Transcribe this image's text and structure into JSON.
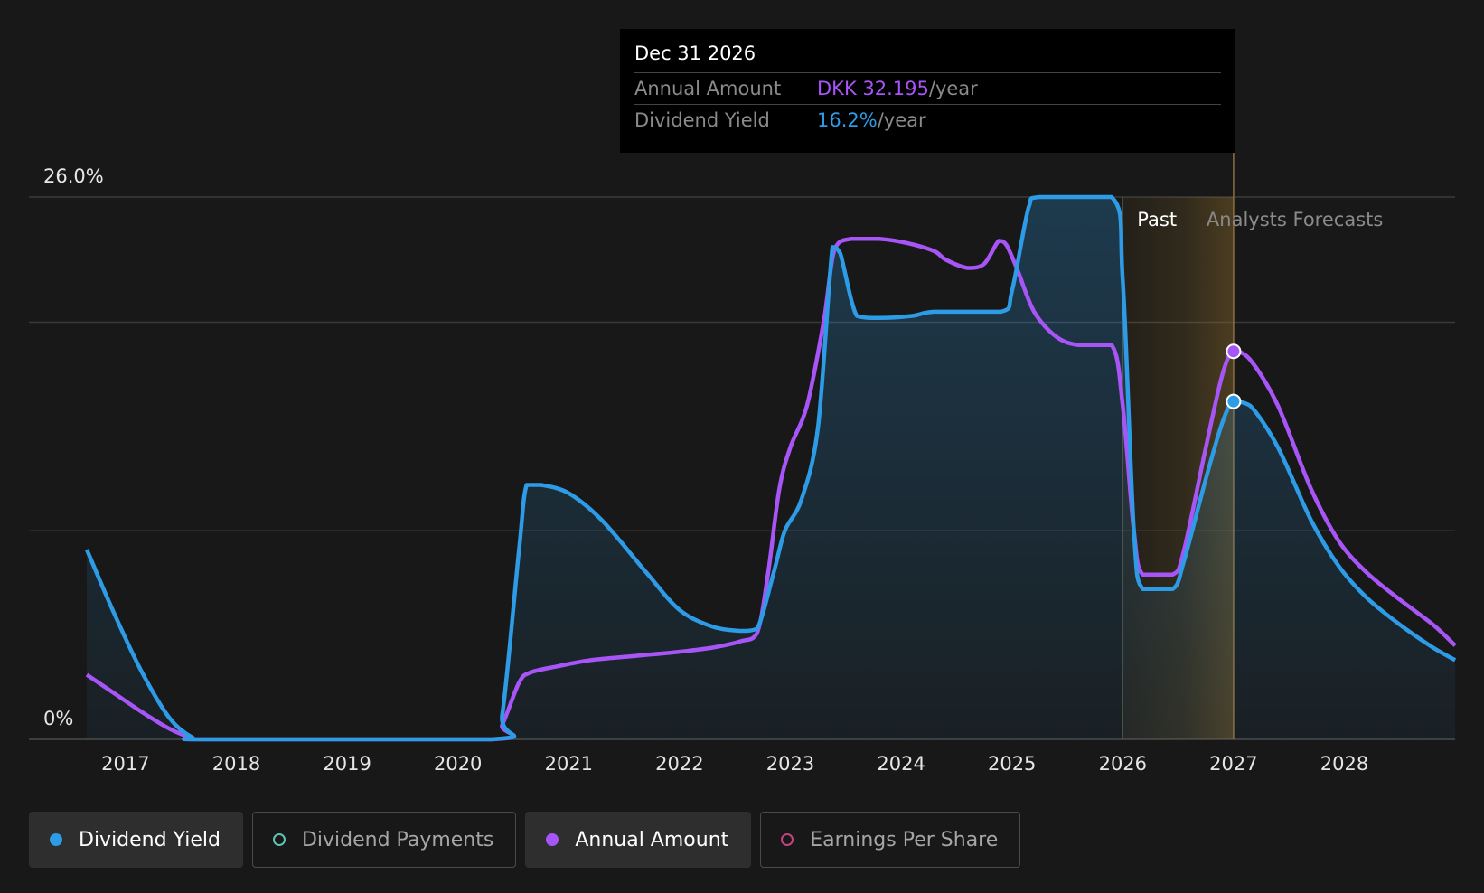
{
  "tooltip": {
    "date": "Dec 31 2026",
    "rows": [
      {
        "label": "Annual Amount",
        "value": "DKK 32.195",
        "unit": "/year",
        "color": "#a855f7"
      },
      {
        "label": "Dividend Yield",
        "value": "16.2%",
        "unit": "/year",
        "color": "#2d9be5"
      }
    ]
  },
  "legend": [
    {
      "label": "Dividend Yield",
      "color": "#2d9be5",
      "filled": true,
      "active": true
    },
    {
      "label": "Dividend Payments",
      "color": "#5ec4b6",
      "filled": false,
      "active": false
    },
    {
      "label": "Annual Amount",
      "color": "#a855f7",
      "filled": true,
      "active": true
    },
    {
      "label": "Earnings Per Share",
      "color": "#c0457e",
      "filled": false,
      "active": false
    }
  ],
  "chart_data": {
    "type": "line",
    "y_top_label": "26.0%",
    "y_bottom_label": "0%",
    "ylim": [
      0,
      26.0
    ],
    "xlim": [
      2016.65,
      2029.0
    ],
    "x_ticks": [
      "2017",
      "2018",
      "2019",
      "2020",
      "2021",
      "2022",
      "2023",
      "2024",
      "2025",
      "2026",
      "2027",
      "2028"
    ],
    "regions": {
      "past_label": "Past",
      "forecast_label": "Analysts Forecasts",
      "past_end": 2026.0,
      "now": 2027.0
    },
    "colors": {
      "yield": "#2d9be5",
      "amount": "#a855f7"
    },
    "series": [
      {
        "name": "Dividend Yield",
        "points": [
          [
            2016.65,
            9.1
          ],
          [
            2016.9,
            6.0
          ],
          [
            2017.15,
            3.2
          ],
          [
            2017.4,
            1.0
          ],
          [
            2017.6,
            0.1
          ],
          [
            2017.75,
            0
          ],
          [
            2020.3,
            0
          ],
          [
            2020.4,
            1.2
          ],
          [
            2020.55,
            9.0
          ],
          [
            2020.62,
            12.2
          ],
          [
            2020.75,
            12.2
          ],
          [
            2021.0,
            11.8
          ],
          [
            2021.3,
            10.5
          ],
          [
            2021.7,
            8.0
          ],
          [
            2022.0,
            6.2
          ],
          [
            2022.3,
            5.4
          ],
          [
            2022.55,
            5.2
          ],
          [
            2022.7,
            5.3
          ],
          [
            2022.85,
            8.0
          ],
          [
            2022.95,
            10.0
          ],
          [
            2023.1,
            11.5
          ],
          [
            2023.25,
            15.0
          ],
          [
            2023.38,
            23.6
          ],
          [
            2023.45,
            23.3
          ],
          [
            2023.6,
            20.3
          ],
          [
            2023.8,
            20.2
          ],
          [
            2024.1,
            20.3
          ],
          [
            2024.3,
            20.5
          ],
          [
            2024.9,
            20.5
          ],
          [
            2025.0,
            21.5
          ],
          [
            2025.15,
            25.5
          ],
          [
            2025.25,
            26.0
          ],
          [
            2025.9,
            26.0
          ],
          [
            2026.0,
            22.0
          ],
          [
            2026.1,
            10.0
          ],
          [
            2026.18,
            7.2
          ],
          [
            2026.45,
            7.2
          ],
          [
            2026.55,
            8.5
          ],
          [
            2026.75,
            12.5
          ],
          [
            2026.9,
            15.2
          ],
          [
            2027.0,
            16.2
          ],
          [
            2027.15,
            16.0
          ],
          [
            2027.4,
            14.0
          ],
          [
            2027.7,
            10.5
          ],
          [
            2027.95,
            8.3
          ],
          [
            2028.2,
            6.8
          ],
          [
            2028.5,
            5.5
          ],
          [
            2028.8,
            4.4
          ],
          [
            2029.0,
            3.8
          ]
        ]
      },
      {
        "name": "Annual Amount",
        "points": [
          [
            2016.65,
            3.1
          ],
          [
            2016.9,
            2.2
          ],
          [
            2017.15,
            1.3
          ],
          [
            2017.4,
            0.5
          ],
          [
            2017.6,
            0.08
          ],
          [
            2017.75,
            0
          ],
          [
            2020.3,
            0
          ],
          [
            2020.4,
            0.7
          ],
          [
            2020.55,
            2.7
          ],
          [
            2020.65,
            3.2
          ],
          [
            2020.9,
            3.5
          ],
          [
            2021.2,
            3.8
          ],
          [
            2021.6,
            4.0
          ],
          [
            2022.0,
            4.2
          ],
          [
            2022.3,
            4.4
          ],
          [
            2022.55,
            4.7
          ],
          [
            2022.7,
            5.1
          ],
          [
            2022.8,
            8.0
          ],
          [
            2022.9,
            12.0
          ],
          [
            2023.0,
            14.0
          ],
          [
            2023.15,
            16.0
          ],
          [
            2023.3,
            20.0
          ],
          [
            2023.4,
            23.5
          ],
          [
            2023.55,
            24.0
          ],
          [
            2023.8,
            24.0
          ],
          [
            2024.05,
            23.8
          ],
          [
            2024.3,
            23.4
          ],
          [
            2024.4,
            23.0
          ],
          [
            2024.6,
            22.6
          ],
          [
            2024.75,
            22.8
          ],
          [
            2024.88,
            23.9
          ],
          [
            2024.95,
            23.7
          ],
          [
            2025.05,
            22.5
          ],
          [
            2025.2,
            20.5
          ],
          [
            2025.4,
            19.3
          ],
          [
            2025.6,
            18.9
          ],
          [
            2025.9,
            18.9
          ],
          [
            2026.0,
            16.0
          ],
          [
            2026.1,
            10.0
          ],
          [
            2026.18,
            7.9
          ],
          [
            2026.45,
            7.9
          ],
          [
            2026.55,
            9.0
          ],
          [
            2026.75,
            14.0
          ],
          [
            2026.9,
            17.5
          ],
          [
            2027.0,
            18.6
          ],
          [
            2027.15,
            18.2
          ],
          [
            2027.4,
            16.0
          ],
          [
            2027.7,
            12.0
          ],
          [
            2027.95,
            9.5
          ],
          [
            2028.2,
            8.0
          ],
          [
            2028.5,
            6.7
          ],
          [
            2028.8,
            5.5
          ],
          [
            2029.0,
            4.5
          ]
        ]
      }
    ]
  }
}
